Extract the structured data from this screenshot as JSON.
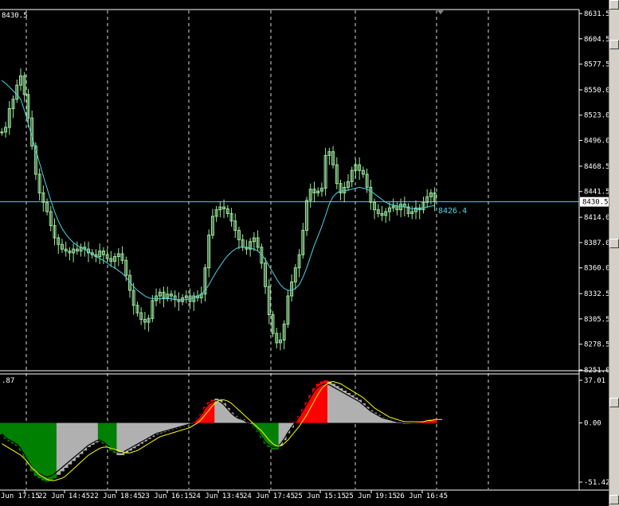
{
  "window": {
    "top_left_label": "8430.5",
    "sub_left_label": ".87"
  },
  "colors": {
    "background": "#000000",
    "candle": "#9ce89c",
    "ma": "#4fd3e8",
    "hist_up": "#ff0000",
    "hist_down": "#008000",
    "hist_neutral": "#b0b0b0",
    "signal": "#ffff00",
    "price_line": "#4fd3e8"
  },
  "price_axis": {
    "ticks": [
      "8631.5",
      "8604.5",
      "8577.5",
      "8550.0",
      "8523.0",
      "8496.0",
      "8468.5",
      "8441.5",
      "8414.0",
      "8387.0",
      "8360.0",
      "8332.5",
      "8305.5",
      "8278.5",
      "8251.0"
    ],
    "current_price": "8430.5",
    "ma_label": "8426.4"
  },
  "indicator_axis": {
    "ticks": [
      "37.01",
      "0.00",
      "-51.42"
    ]
  },
  "time_axis": {
    "labels": [
      "Jun 17:15",
      "22 Jun 14:45",
      "22 Jun 18:45",
      "23 Jun 16:15",
      "24 Jun 13:45",
      "24 Jun 17:45",
      "25 Jun 15:15",
      "25 Jun 19:15",
      "26 Jun 16:45"
    ]
  },
  "chart_data": {
    "type": "line",
    "ylim": [
      8251.0,
      8631.5
    ],
    "close": [
      8505,
      8510,
      8530,
      8540,
      8555,
      8565,
      8545,
      8520,
      8490,
      8460,
      8440,
      8430,
      8420,
      8405,
      8392,
      8385,
      8380,
      8378,
      8376,
      8380,
      8378,
      8382,
      8380,
      8376,
      8374,
      8372,
      8378,
      8374,
      8370,
      8367,
      8372,
      8375,
      8368,
      8352,
      8336,
      8320,
      8312,
      8305,
      8302,
      8306,
      8325,
      8330,
      8334,
      8328,
      8332,
      8330,
      8326,
      8324,
      8328,
      8330,
      8324,
      8330,
      8328,
      8332,
      8360,
      8395,
      8415,
      8422,
      8425,
      8423,
      8418,
      8410,
      8400,
      8390,
      8382,
      8380,
      8388,
      8392,
      8382,
      8365,
      8340,
      8310,
      8290,
      8280,
      8283,
      8300,
      8330,
      8345,
      8360,
      8374,
      8400,
      8432,
      8444,
      8440,
      8442,
      8445,
      8480,
      8484,
      8470,
      8450,
      8440,
      8446,
      8452,
      8464,
      8470,
      8464,
      8460,
      8446,
      8430,
      8422,
      8418,
      8416,
      8420,
      8424,
      8426,
      8422,
      8428,
      8425,
      8418,
      8420,
      8424,
      8422,
      8430,
      8436,
      8440,
      8430.5
    ],
    "ma": [
      8560,
      8557,
      8553,
      8549,
      8545,
      8540,
      8528,
      8514,
      8500,
      8486,
      8472,
      8458,
      8445,
      8432,
      8420,
      8410,
      8402,
      8396,
      8391,
      8387,
      8384,
      8382,
      8380,
      8377,
      8375,
      8372,
      8370,
      8368,
      8365,
      8362,
      8360,
      8357,
      8354,
      8350,
      8345,
      8340,
      8336,
      8333,
      8330,
      8328,
      8327,
      8327,
      8327,
      8327,
      8327,
      8327,
      8326,
      8326,
      8326,
      8326,
      8327,
      8328,
      8330,
      8332,
      8336,
      8342,
      8349,
      8356,
      8362,
      8368,
      8373,
      8377,
      8380,
      8382,
      8382,
      8382,
      8381,
      8380,
      8378,
      8374,
      8369,
      8362,
      8355,
      8348,
      8342,
      8338,
      8336,
      8336,
      8338,
      8342,
      8350,
      8360,
      8372,
      8384,
      8394,
      8404,
      8416,
      8428,
      8436,
      8440,
      8442,
      8442,
      8443,
      8444,
      8445,
      8446,
      8445,
      8444,
      8442,
      8439,
      8436,
      8433,
      8430,
      8428,
      8427,
      8426,
      8426,
      8425,
      8424,
      8423,
      8423,
      8423,
      8424,
      8425,
      8426,
      8426.4
    ],
    "hist": [
      -10,
      -14,
      -16,
      -18,
      -20,
      -24,
      -30,
      -36,
      -42,
      -46,
      -48,
      -50,
      -51,
      -50,
      -48,
      -45,
      -42,
      -39,
      -36,
      -33,
      -30,
      -27,
      -24,
      -21,
      -19,
      -17,
      -16,
      -18,
      -21,
      -24,
      -26,
      -28,
      -28,
      -26,
      -24,
      -22,
      -20,
      -18,
      -16,
      -14,
      -12,
      -10,
      -9,
      -8,
      -7,
      -6,
      -5,
      -4,
      -3,
      -2,
      -1,
      1,
      4,
      8,
      14,
      18,
      20,
      21,
      20,
      17,
      13,
      9,
      6,
      4,
      3,
      1,
      -1,
      -4,
      -8,
      -13,
      -18,
      -21,
      -23,
      -23,
      -20,
      -15,
      -9,
      -4,
      1,
      6,
      12,
      18,
      24,
      30,
      34,
      36,
      37,
      36,
      34,
      32,
      30,
      28,
      26,
      24,
      22,
      20,
      17,
      14,
      11,
      9,
      7,
      5,
      4,
      3,
      2,
      1,
      1,
      0,
      0,
      0,
      0,
      1,
      2,
      3,
      4,
      3
    ],
    "signal": [
      -18,
      -20,
      -22,
      -24,
      -26,
      -28,
      -31,
      -35,
      -39,
      -42,
      -45,
      -47,
      -49,
      -50,
      -50,
      -49,
      -48,
      -46,
      -43,
      -40,
      -37,
      -34,
      -31,
      -28,
      -26,
      -24,
      -22,
      -21,
      -21,
      -22,
      -23,
      -24,
      -25,
      -26,
      -26,
      -25,
      -24,
      -22,
      -20,
      -18,
      -16,
      -14,
      -12,
      -11,
      -10,
      -9,
      -8,
      -7,
      -6,
      -5,
      -4,
      -2,
      0,
      3,
      7,
      11,
      15,
      18,
      20,
      20,
      19,
      17,
      14,
      11,
      8,
      5,
      2,
      -1,
      -4,
      -7,
      -11,
      -15,
      -18,
      -20,
      -20,
      -18,
      -15,
      -11,
      -7,
      -3,
      2,
      7,
      13,
      19,
      25,
      30,
      33,
      35,
      36,
      35,
      34,
      32,
      30,
      28,
      26,
      24,
      22,
      19,
      16,
      13,
      11,
      9,
      7,
      5,
      4,
      3,
      2,
      1,
      1,
      1,
      1,
      1,
      1,
      2,
      2,
      3,
      3,
      3
    ],
    "hist_colors": [
      "G",
      "G",
      "G",
      "G",
      "G",
      "G",
      "G",
      "G",
      "G",
      "G",
      "G",
      "G",
      "G",
      "G",
      "G",
      "N",
      "N",
      "N",
      "N",
      "N",
      "N",
      "N",
      "N",
      "N",
      "N",
      "N",
      "G",
      "G",
      "G",
      "G",
      "G",
      "N",
      "N",
      "N",
      "N",
      "N",
      "N",
      "N",
      "N",
      "N",
      "N",
      "N",
      "N",
      "N",
      "N",
      "N",
      "N",
      "N",
      "N",
      "N",
      "N",
      "R",
      "R",
      "R",
      "R",
      "R",
      "R",
      "N",
      "N",
      "N",
      "N",
      "N",
      "N",
      "N",
      "N",
      "N",
      "N",
      "G",
      "G",
      "G",
      "G",
      "G",
      "G",
      "G",
      "N",
      "N",
      "N",
      "N",
      "R",
      "R",
      "R",
      "R",
      "R",
      "R",
      "R",
      "R",
      "R",
      "N",
      "N",
      "N",
      "N",
      "N",
      "N",
      "N",
      "N",
      "N",
      "N",
      "N",
      "N",
      "N",
      "N",
      "N",
      "N",
      "N",
      "N",
      "N",
      "N",
      "N",
      "N",
      "R",
      "R",
      "R",
      "R",
      "R",
      "R",
      "R"
    ]
  }
}
